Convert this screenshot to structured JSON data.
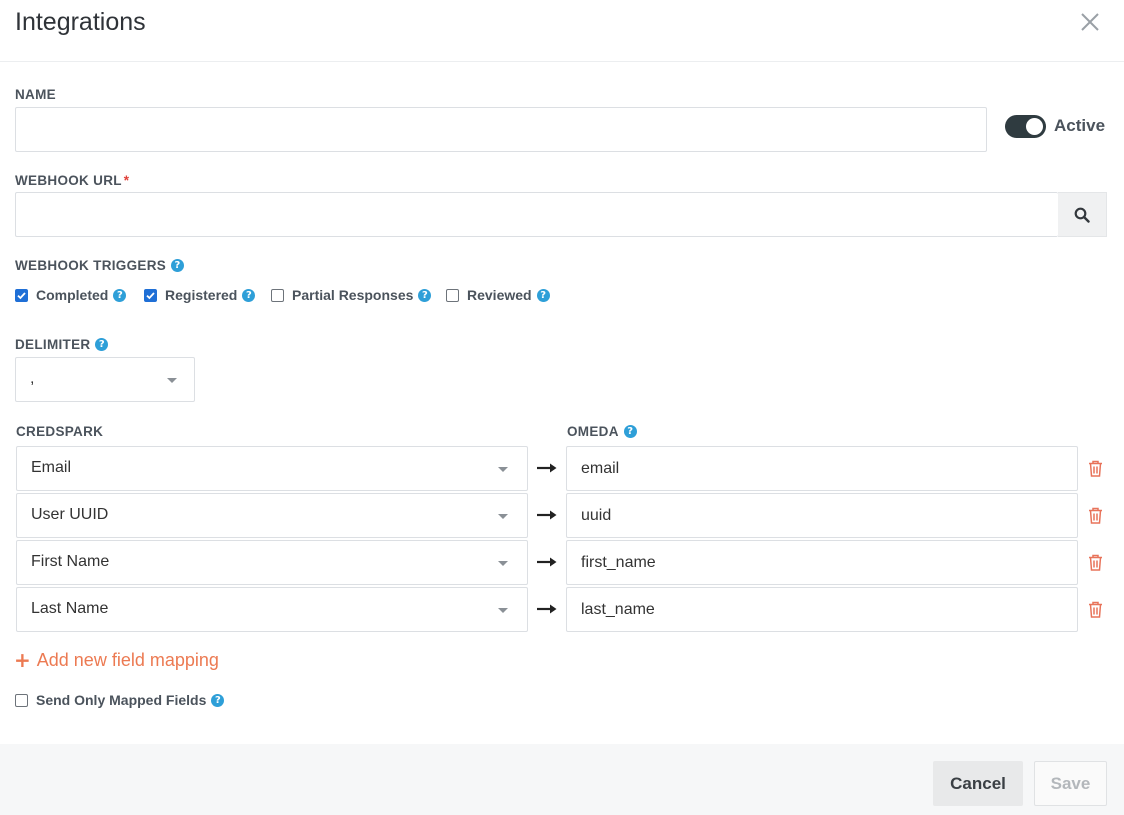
{
  "dialog": {
    "title": "Integrations",
    "close_icon": "close-icon"
  },
  "name": {
    "label": "NAME",
    "value": "",
    "placeholder": ""
  },
  "active_toggle": {
    "label": "Active",
    "on": true
  },
  "webhook_url": {
    "label": "WEBHOOK URL",
    "required_mark": "*",
    "value": "",
    "placeholder": ""
  },
  "webhook_triggers": {
    "label": "WEBHOOK TRIGGERS",
    "options": [
      {
        "label": "Completed",
        "checked": true
      },
      {
        "label": "Registered",
        "checked": true
      },
      {
        "label": "Partial Responses",
        "checked": false
      },
      {
        "label": "Reviewed",
        "checked": false
      }
    ]
  },
  "delimiter": {
    "label": "DELIMITER",
    "value": ","
  },
  "mapping": {
    "credspark_label": "CREDSPARK",
    "omeda_label": "OMEDA",
    "rows": [
      {
        "credspark": "Email",
        "omeda": "email"
      },
      {
        "credspark": "User UUID",
        "omeda": "uuid"
      },
      {
        "credspark": "First Name",
        "omeda": "first_name"
      },
      {
        "credspark": "Last Name",
        "omeda": "last_name"
      }
    ],
    "add_label": "Add new field mapping"
  },
  "send_only_mapped": {
    "label": "Send Only Mapped Fields",
    "checked": false
  },
  "footer": {
    "cancel_label": "Cancel",
    "save_label": "Save"
  },
  "colors": {
    "accent": "#ec7a52",
    "help": "#2e9fd8",
    "checkbox": "#1f6fd6",
    "toggle": "#2f3b40",
    "delete": "#e8735a"
  }
}
